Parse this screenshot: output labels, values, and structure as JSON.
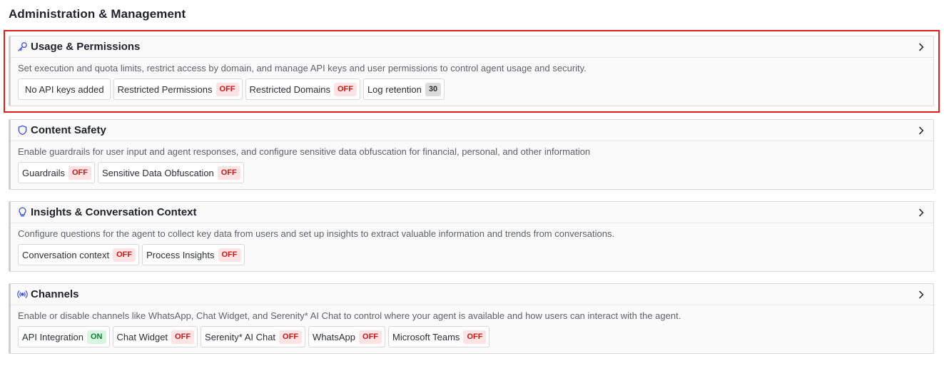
{
  "page": {
    "title": "Administration & Management"
  },
  "colors": {
    "selection_outline": "#e21b1b",
    "off_badge_bg": "#fde3e3",
    "off_badge_text": "#c41a1a",
    "on_badge_bg": "#d8f5e1",
    "on_badge_text": "#137a36",
    "icon_blue": "#3b4fd6"
  },
  "sections": [
    {
      "title": "Usage & Permissions",
      "icon": "key-icon",
      "description": "Set execution and quota limits, restrict access by domain, and manage API keys and user permissions to control agent usage and security.",
      "chips": [
        {
          "label": "No API keys added",
          "badge": ""
        },
        {
          "label": "Restricted Permissions",
          "badge": "OFF"
        },
        {
          "label": "Restricted Domains",
          "badge": "OFF"
        },
        {
          "label": "Log retention",
          "badge": "30"
        }
      ]
    },
    {
      "title": "Content Safety",
      "icon": "shield-icon",
      "description": "Enable guardrails for user input and agent responses, and configure sensitive data obfuscation for financial, personal, and other information",
      "chips": [
        {
          "label": "Guardrails",
          "badge": "OFF"
        },
        {
          "label": "Sensitive Data Obfuscation",
          "badge": "OFF"
        }
      ]
    },
    {
      "title": "Insights & Conversation Context",
      "icon": "lightbulb-icon",
      "description": "Configure questions for the agent to collect key data from users and set up insights to extract valuable information and trends from conversations.",
      "chips": [
        {
          "label": "Conversation context",
          "badge": "OFF"
        },
        {
          "label": "Process Insights",
          "badge": "OFF"
        }
      ]
    },
    {
      "title": "Channels",
      "icon": "broadcast-icon",
      "description": "Enable or disable channels like WhatsApp, Chat Widget, and Serenity* AI Chat to control where your agent is available and how users can interact with the agent.",
      "chips": [
        {
          "label": "API Integration",
          "badge": "ON"
        },
        {
          "label": "Chat Widget",
          "badge": "OFF"
        },
        {
          "label": "Serenity* AI Chat",
          "badge": "OFF"
        },
        {
          "label": "WhatsApp",
          "badge": "OFF"
        },
        {
          "label": "Microsoft Teams",
          "badge": "OFF"
        }
      ]
    }
  ]
}
